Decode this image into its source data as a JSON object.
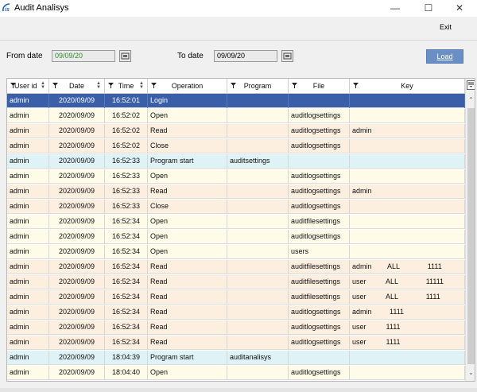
{
  "window": {
    "title": "Audit Analisys",
    "minimize": "—",
    "maximize": "☐",
    "close": "✕"
  },
  "toolbar": {
    "exit_label": "Exit"
  },
  "filters": {
    "from_label": "From date",
    "from_value": "09/09/20",
    "to_label": "To date",
    "to_value": "09/09/20",
    "load_label": "Load"
  },
  "colors": {
    "selected_row": "#3a5ea8",
    "open_row": "#fefbe8",
    "readclose_row": "#fdefe0",
    "program_row": "#dff2f6",
    "load_button": "#6a8fc4"
  },
  "columns": [
    {
      "key": "user",
      "label": "User id"
    },
    {
      "key": "date",
      "label": "Date"
    },
    {
      "key": "time",
      "label": "Time"
    },
    {
      "key": "op",
      "label": "Operation"
    },
    {
      "key": "program",
      "label": "Program"
    },
    {
      "key": "file",
      "label": "File"
    },
    {
      "key": "key",
      "label": "Key"
    }
  ],
  "rows": [
    {
      "user": "admin",
      "date": "2020/09/09",
      "time": "16:52:01",
      "op": "Login",
      "program": "",
      "file": "",
      "key": "",
      "kind": "selected"
    },
    {
      "user": "admin",
      "date": "2020/09/09",
      "time": "16:52:02",
      "op": "Open",
      "program": "",
      "file": "auditlogsettings",
      "key": "",
      "kind": "open"
    },
    {
      "user": "admin",
      "date": "2020/09/09",
      "time": "16:52:02",
      "op": "Read",
      "program": "",
      "file": "auditlogsettings",
      "key": "admin",
      "kind": "rc"
    },
    {
      "user": "admin",
      "date": "2020/09/09",
      "time": "16:52:02",
      "op": "Close",
      "program": "",
      "file": "auditlogsettings",
      "key": "",
      "kind": "rc"
    },
    {
      "user": "admin",
      "date": "2020/09/09",
      "time": "16:52:33",
      "op": "Program start",
      "program": "auditsettings",
      "file": "",
      "key": "",
      "kind": "prog"
    },
    {
      "user": "admin",
      "date": "2020/09/09",
      "time": "16:52:33",
      "op": "Open",
      "program": "",
      "file": "auditlogsettings",
      "key": "",
      "kind": "open"
    },
    {
      "user": "admin",
      "date": "2020/09/09",
      "time": "16:52:33",
      "op": "Read",
      "program": "",
      "file": "auditlogsettings",
      "key": "admin",
      "kind": "rc"
    },
    {
      "user": "admin",
      "date": "2020/09/09",
      "time": "16:52:33",
      "op": "Close",
      "program": "",
      "file": "auditlogsettings",
      "key": "",
      "kind": "rc"
    },
    {
      "user": "admin",
      "date": "2020/09/09",
      "time": "16:52:34",
      "op": "Open",
      "program": "",
      "file": "auditfilesettings",
      "key": "",
      "kind": "open"
    },
    {
      "user": "admin",
      "date": "2020/09/09",
      "time": "16:52:34",
      "op": "Open",
      "program": "",
      "file": "auditlogsettings",
      "key": "",
      "kind": "open"
    },
    {
      "user": "admin",
      "date": "2020/09/09",
      "time": "16:52:34",
      "op": "Open",
      "program": "",
      "file": "users",
      "key": "",
      "kind": "open"
    },
    {
      "user": "admin",
      "date": "2020/09/09",
      "time": "16:52:34",
      "op": "Read",
      "program": "",
      "file": "auditfilesettings",
      "key": "admin        ALL              1111",
      "kind": "rc"
    },
    {
      "user": "admin",
      "date": "2020/09/09",
      "time": "16:52:34",
      "op": "Read",
      "program": "",
      "file": "auditfilesettings",
      "key": "user          ALL              11111",
      "kind": "rc"
    },
    {
      "user": "admin",
      "date": "2020/09/09",
      "time": "16:52:34",
      "op": "Read",
      "program": "",
      "file": "auditfilesettings",
      "key": "user          ALL              1111",
      "kind": "rc"
    },
    {
      "user": "admin",
      "date": "2020/09/09",
      "time": "16:52:34",
      "op": "Read",
      "program": "",
      "file": "auditlogsettings",
      "key": "admin         1111",
      "kind": "rc"
    },
    {
      "user": "admin",
      "date": "2020/09/09",
      "time": "16:52:34",
      "op": "Read",
      "program": "",
      "file": "auditlogsettings",
      "key": "user          1111",
      "kind": "rc"
    },
    {
      "user": "admin",
      "date": "2020/09/09",
      "time": "16:52:34",
      "op": "Read",
      "program": "",
      "file": "auditlogsettings",
      "key": "user          1111",
      "kind": "rc"
    },
    {
      "user": "admin",
      "date": "2020/09/09",
      "time": "18:04:39",
      "op": "Program start",
      "program": "auditanalisys",
      "file": "",
      "key": "",
      "kind": "prog"
    },
    {
      "user": "admin",
      "date": "2020/09/09",
      "time": "18:04:40",
      "op": "Open",
      "program": "",
      "file": "auditlogsettings",
      "key": "",
      "kind": "open"
    }
  ]
}
